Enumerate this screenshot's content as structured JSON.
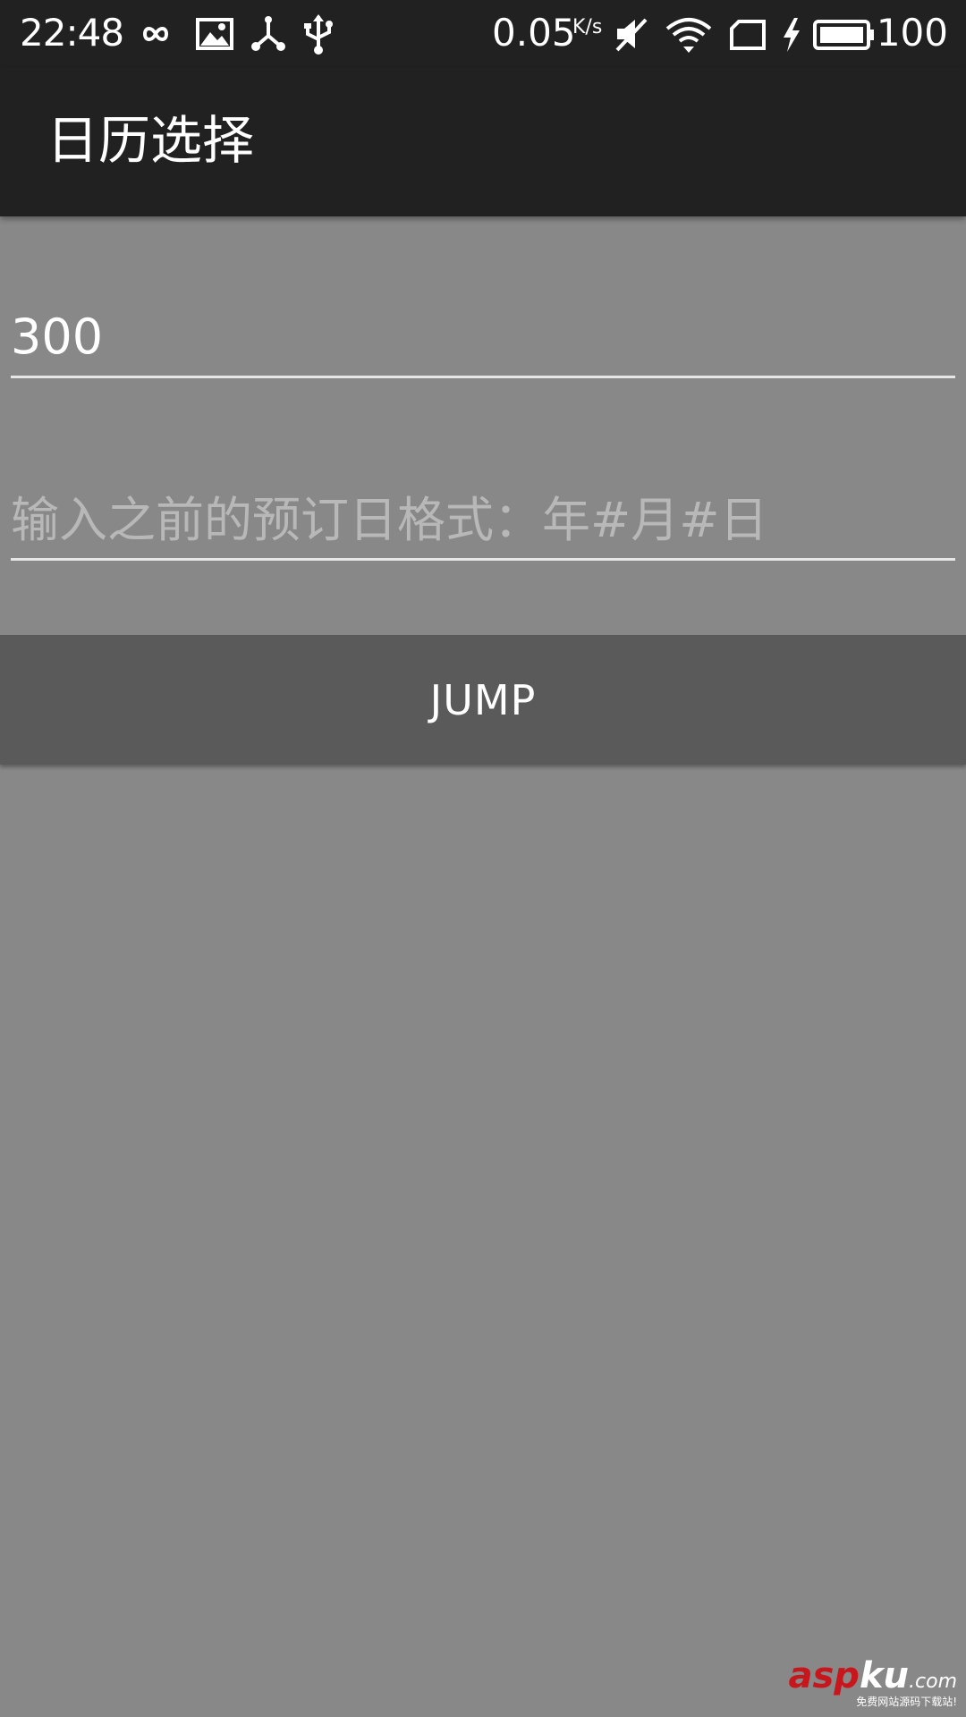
{
  "status_bar": {
    "time": "22:48",
    "network_speed": "0.05",
    "network_speed_unit": "K/s",
    "battery_level": "100",
    "icons": [
      "infinity-icon",
      "image-icon",
      "share-icon",
      "usb-icon",
      "mute-icon",
      "wifi-icon",
      "sim-icon",
      "charging-icon",
      "battery-icon"
    ]
  },
  "app_bar": {
    "title": "日历选择"
  },
  "form": {
    "days_input": {
      "value": "300",
      "placeholder": ""
    },
    "date_input": {
      "value": "",
      "placeholder": "输入之前的预订日格式：年#月#日"
    },
    "jump_button": {
      "label": "JUMP"
    }
  },
  "watermark": {
    "brand_red": "asp",
    "brand_white": "ku",
    "domain": ".com",
    "tagline": "免费网站源码下载站!"
  },
  "colors": {
    "status_bar_bg": "#212121",
    "app_bar_bg": "#212121",
    "content_bg": "#888888",
    "button_bg": "#5a5a5a",
    "brand_red": "#c8161d"
  }
}
